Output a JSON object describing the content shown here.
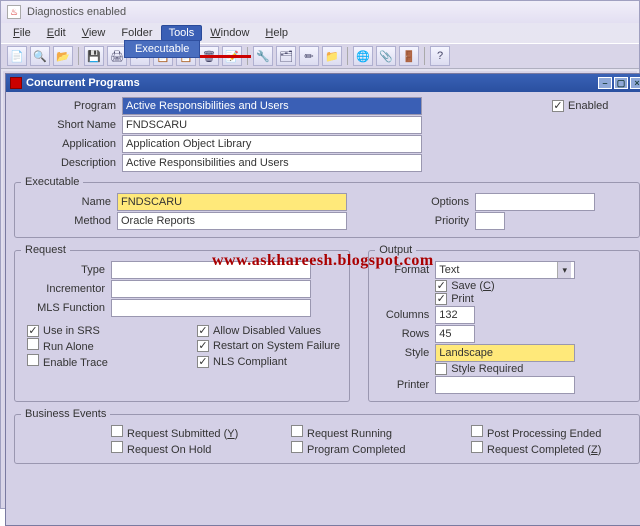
{
  "window": {
    "title": "Diagnostics enabled"
  },
  "menu": {
    "items": [
      "File",
      "Edit",
      "View",
      "Folder",
      "Tools",
      "Window",
      "Help"
    ],
    "selected": {
      "label": "Tools",
      "dropdown_first": "Executable"
    }
  },
  "child_window": {
    "title": "Concurrent Programs"
  },
  "program": {
    "program_label": "Program",
    "program_value": "Active Responsibilities and Users",
    "enabled_label": "Enabled",
    "enabled_checked": true,
    "short_name_label": "Short Name",
    "short_name_value": "FNDSCARU",
    "application_label": "Application",
    "application_value": "Application Object Library",
    "description_label": "Description",
    "description_value": "Active Responsibilities and Users"
  },
  "executable": {
    "legend": "Executable",
    "name_label": "Name",
    "name_value": "FNDSCARU",
    "method_label": "Method",
    "method_value": "Oracle Reports",
    "options_label": "Options",
    "options_value": "",
    "priority_label": "Priority",
    "priority_value": ""
  },
  "request": {
    "legend": "Request",
    "type_label": "Type",
    "type_value": "",
    "incrementor_label": "Incrementor",
    "incrementor_value": "",
    "mls_label": "MLS Function",
    "mls_value": "",
    "use_in_srs_label": "Use in SRS",
    "allow_disabled_label": "Allow Disabled Values",
    "run_alone_label": "Run Alone",
    "restart_label": "Restart on System Failure",
    "enable_trace_label": "Enable Trace",
    "nls_label": "NLS Compliant"
  },
  "output": {
    "legend": "Output",
    "format_label": "Format",
    "format_value": "Text",
    "save_label": "Save (C)",
    "print_label": "Print",
    "columns_label": "Columns",
    "columns_value": "132",
    "rows_label": "Rows",
    "rows_value": "45",
    "style_label": "Style",
    "style_value": "Landscape",
    "style_required_label": "Style Required",
    "printer_label": "Printer",
    "printer_value": ""
  },
  "business_events": {
    "legend": "Business Events",
    "req_submitted": "Request Submitted (Y)",
    "req_running": "Request Running",
    "post_processing": "Post Processing Ended",
    "req_on_hold": "Request On Hold",
    "program_completed": "Program Completed",
    "req_completed": "Request Completed (Z)"
  },
  "watermark": "www.askhareesh.blogspot.com",
  "icons": {
    "tb": [
      "📄",
      "🔍",
      "📂",
      "💾",
      "🖨",
      "✂",
      "📋",
      "📋",
      "🗑",
      "📝",
      "🔧",
      "🗂",
      "✏",
      "📁",
      "🌐",
      "📎",
      "🚪",
      "?"
    ]
  }
}
